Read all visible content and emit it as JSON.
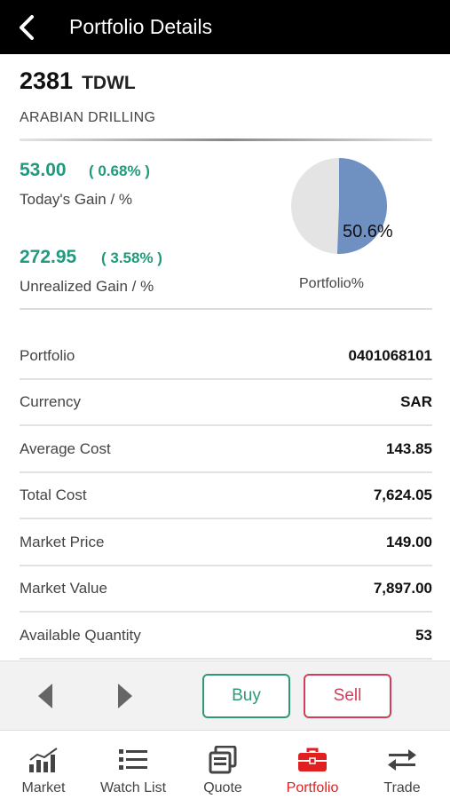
{
  "header": {
    "title": "Portfolio Details",
    "back_icon": "chevron-left-icon"
  },
  "symbol": {
    "code": "2381",
    "exchange": "TDWL",
    "company": "ARABIAN DRILLING"
  },
  "gains": {
    "today": {
      "value": "53.00",
      "percent": "( 0.68% )",
      "label": "Today's Gain  /  %"
    },
    "unrealized": {
      "value": "272.95",
      "percent": "( 3.58% )",
      "label": "Unrealized Gain  /  %"
    }
  },
  "portfolio_share": {
    "percent_label": "50.6%",
    "fraction": 0.506,
    "caption": "Portfolio%",
    "colors": {
      "share": "#6f91c2",
      "rest": "#e4e4e4"
    }
  },
  "details": [
    {
      "label": "Portfolio",
      "value": "0401068101"
    },
    {
      "label": "Currency",
      "value": "SAR"
    },
    {
      "label": "Average Cost",
      "value": "143.85"
    },
    {
      "label": "Total Cost",
      "value": "7,624.05"
    },
    {
      "label": "Market Price",
      "value": "149.00"
    },
    {
      "label": "Market Value",
      "value": "7,897.00"
    },
    {
      "label": "Available Quantity",
      "value": "53"
    }
  ],
  "actions": {
    "buy_label": "Buy",
    "sell_label": "Sell",
    "prev_icon": "triangle-left-icon",
    "next_icon": "triangle-right-icon"
  },
  "tabs": [
    {
      "label": "Market",
      "icon": "bar-chart-icon",
      "active": false
    },
    {
      "label": "Watch List",
      "icon": "list-icon",
      "active": false
    },
    {
      "label": "Quote",
      "icon": "quote-window-icon",
      "active": false
    },
    {
      "label": "Portfolio",
      "icon": "briefcase-icon",
      "active": true
    },
    {
      "label": "Trade",
      "icon": "swap-arrows-icon",
      "active": false
    }
  ],
  "colors": {
    "gain": "#1f9a7c",
    "buy": "#2e9a75",
    "sell": "#d23d5a",
    "active_tab": "#e02020"
  }
}
